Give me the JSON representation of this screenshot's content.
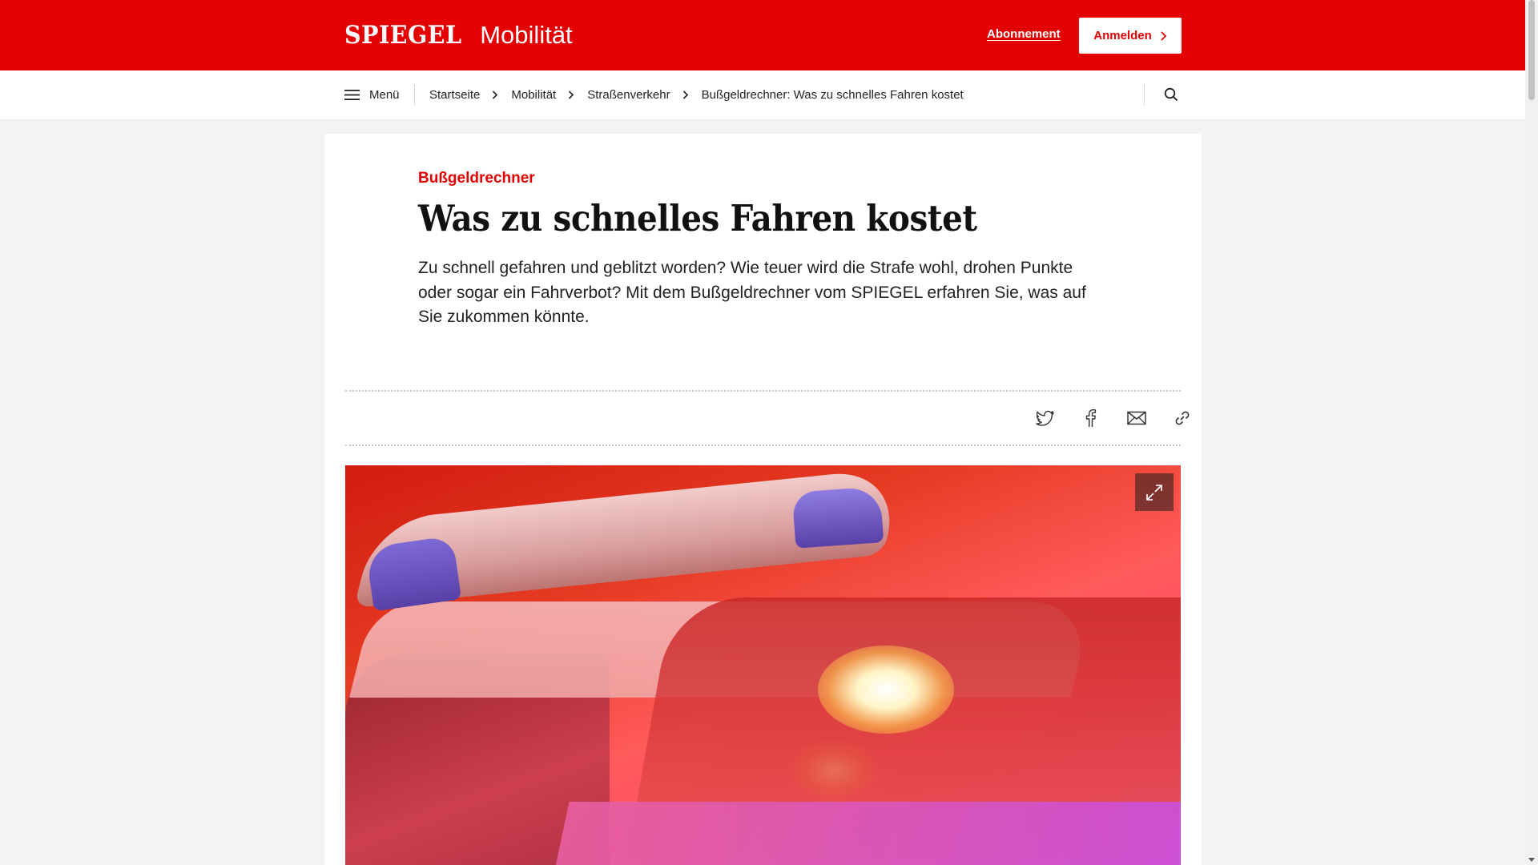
{
  "header": {
    "brand_logo": "SPIEGEL",
    "brand_section": "Mobilität",
    "subscription_link": "Abonnement",
    "login_button": "Anmelden"
  },
  "nav": {
    "menu_label": "Menü",
    "breadcrumb": [
      {
        "label": "Startseite"
      },
      {
        "label": "Mobilität"
      },
      {
        "label": "Straßenverkehr"
      }
    ],
    "current": "Bußgeldrechner: Was zu schnelles Fahren kostet"
  },
  "article": {
    "kicker": "Bußgeldrechner",
    "headline": "Was zu schnelles Fahren kostet",
    "teaser": "Zu schnell gefahren und geblitzt worden? Wie teuer wird die Strafe wohl, drohen Punkte oder sogar ein Fahrverbot? Mit dem Bußgeldrechner vom SPIEGEL erfahren Sie, was auf Sie zukommen könnte."
  },
  "share": {
    "icons": [
      "twitter-icon",
      "facebook-icon",
      "mail-icon",
      "link-icon"
    ]
  },
  "colors": {
    "brand_red": "#e40000",
    "text": "#222222"
  }
}
